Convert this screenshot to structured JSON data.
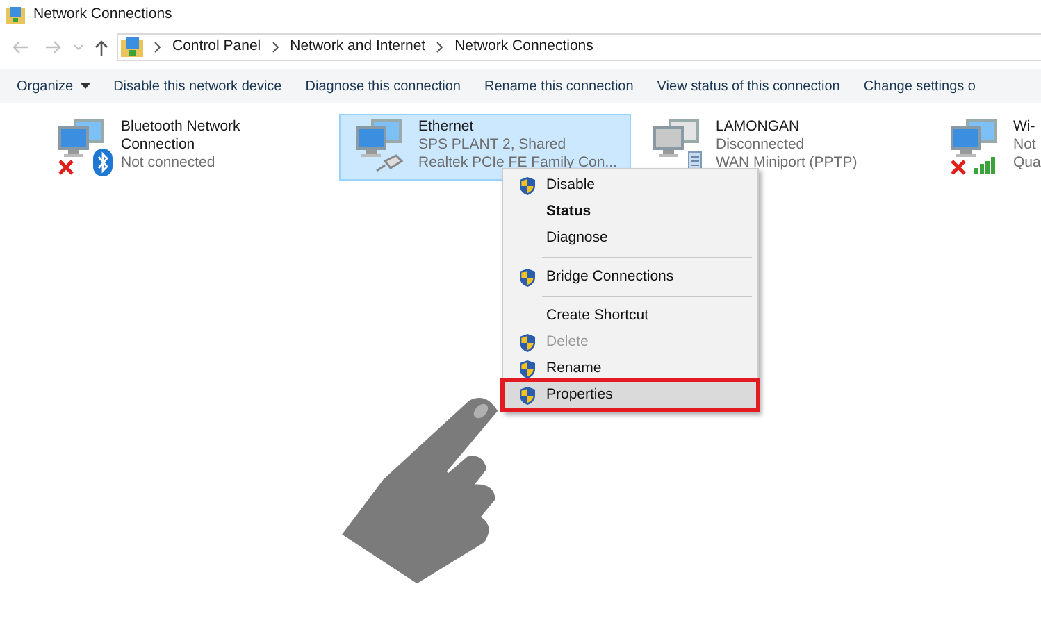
{
  "window": {
    "title": "Network Connections"
  },
  "breadcrumb": [
    "Control Panel",
    "Network and Internet",
    "Network Connections"
  ],
  "toolbar": [
    {
      "label": "Organize",
      "dropdown": true
    },
    {
      "label": "Disable this network device",
      "dropdown": false
    },
    {
      "label": "Diagnose this connection",
      "dropdown": false
    },
    {
      "label": "Rename this connection",
      "dropdown": false
    },
    {
      "label": "View status of this connection",
      "dropdown": false
    },
    {
      "label": "Change settings o",
      "dropdown": false
    }
  ],
  "connections": [
    {
      "name": "Bluetooth Network Connection",
      "status": "Not connected",
      "kind": "bluetooth",
      "error": true,
      "dimmed": false,
      "selected": false
    },
    {
      "name": "Ethernet",
      "status": "SPS PLANT 2, Shared",
      "device": "Realtek PCIe FE Family Con...",
      "kind": "cable",
      "error": false,
      "dimmed": false,
      "selected": true
    },
    {
      "name": "LAMONGAN",
      "status": "Disconnected",
      "device": "WAN Miniport (PPTP)",
      "kind": "modem",
      "error": false,
      "dimmed": true,
      "selected": false
    },
    {
      "name": "Wi-",
      "status": "Not",
      "device": "Qua",
      "kind": "wifi",
      "error": true,
      "dimmed": false,
      "selected": false
    }
  ],
  "context_menu": [
    {
      "kind": "item",
      "label": "Disable",
      "shield": true,
      "bold": false,
      "disabled": false,
      "selected": false,
      "outlined": false
    },
    {
      "kind": "item",
      "label": "Status",
      "shield": false,
      "bold": true,
      "disabled": false,
      "selected": false,
      "outlined": false
    },
    {
      "kind": "item",
      "label": "Diagnose",
      "shield": false,
      "bold": false,
      "disabled": false,
      "selected": false,
      "outlined": false
    },
    {
      "kind": "separator"
    },
    {
      "kind": "item",
      "label": "Bridge Connections",
      "shield": true,
      "bold": false,
      "disabled": false,
      "selected": false,
      "outlined": false
    },
    {
      "kind": "separator"
    },
    {
      "kind": "item",
      "label": "Create Shortcut",
      "shield": false,
      "bold": false,
      "disabled": false,
      "selected": false,
      "outlined": false
    },
    {
      "kind": "item",
      "label": "Delete",
      "shield": true,
      "bold": false,
      "disabled": true,
      "selected": false,
      "outlined": false
    },
    {
      "kind": "item",
      "label": "Rename",
      "shield": true,
      "bold": false,
      "disabled": false,
      "selected": false,
      "outlined": false
    },
    {
      "kind": "item",
      "label": "Properties",
      "shield": true,
      "bold": false,
      "disabled": false,
      "selected": true,
      "outlined": true
    }
  ]
}
